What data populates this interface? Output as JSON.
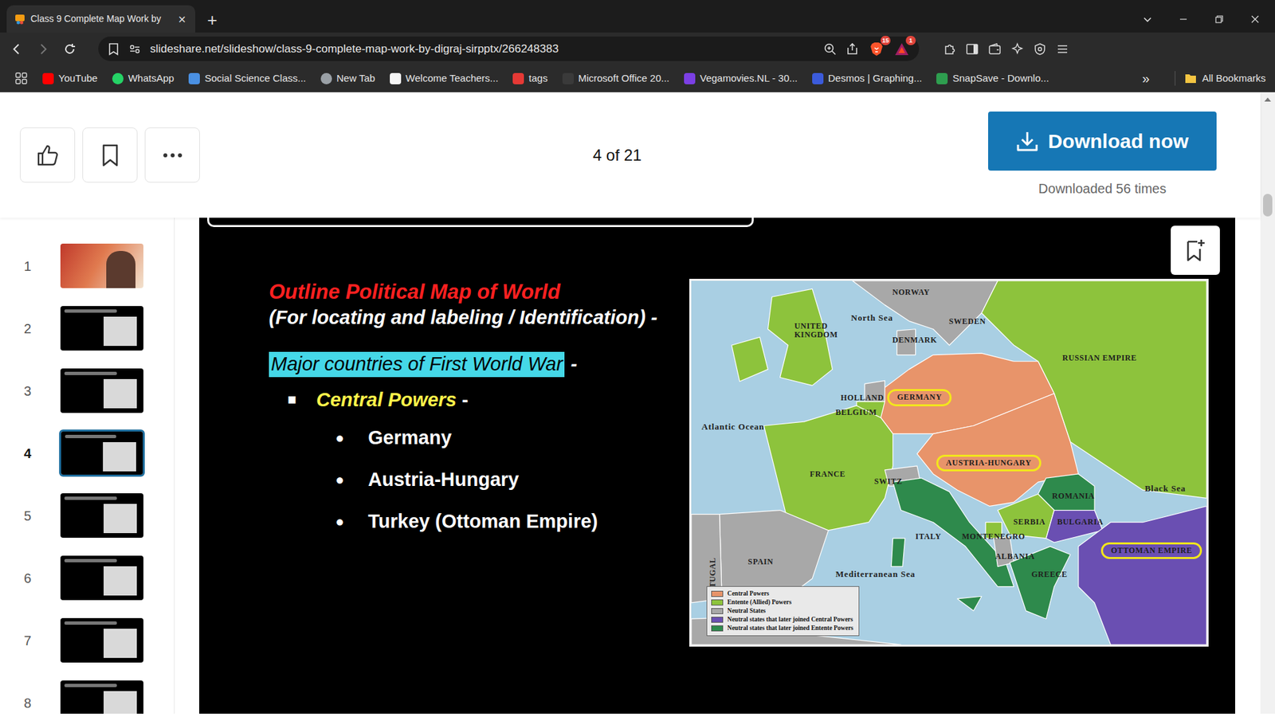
{
  "browser": {
    "tab": {
      "title": "Class 9 Complete Map Work by",
      "close": "×",
      "selected": true
    },
    "new_tab": "+",
    "url": "slideshare.net/slideshow/class-9-complete-map-work-by-digraj-sirpptx/266248383",
    "badges": [
      "15",
      "1"
    ],
    "bookmarks": [
      "YouTube",
      "WhatsApp",
      "Social Science Class...",
      "New Tab",
      "Welcome Teachers...",
      "tags",
      "Microsoft Office 20...",
      "Vegamovies.NL - 30...",
      "Desmos | Graphing...",
      "SnapSave - Downlo..."
    ],
    "bookmarks_overflow": "»",
    "all_bookmarks": "All Bookmarks"
  },
  "toolbar": {
    "page_indicator": "4 of 21",
    "download": "Download now",
    "download_count": "Downloaded 56 times"
  },
  "thumbnails": [
    {
      "number": "1",
      "kind": "cover",
      "selected": false
    },
    {
      "number": "2",
      "kind": "slide",
      "selected": false
    },
    {
      "number": "3",
      "kind": "slide",
      "selected": false
    },
    {
      "number": "4",
      "kind": "slide",
      "selected": true
    },
    {
      "number": "5",
      "kind": "slide",
      "selected": false
    },
    {
      "number": "6",
      "kind": "slide",
      "selected": false
    },
    {
      "number": "7",
      "kind": "slide",
      "selected": false
    },
    {
      "number": "8",
      "kind": "slide",
      "selected": false
    }
  ],
  "slide": {
    "heading": "Outline Political Map of World",
    "subheading": "(For locating and labeling / Identification) -",
    "highlight": "Major countries of First World War",
    "highlight_suffix": "-",
    "group_bullet": "■",
    "group_title": "Central Powers",
    "group_suffix": "-",
    "item_bullet": "●",
    "items": [
      "Germany",
      "Austria-Hungary",
      "Turkey (Ottoman Empire)"
    ]
  },
  "map": {
    "labels": [
      {
        "text": "NORWAY",
        "kind": "land",
        "highlighted": false
      },
      {
        "text": "SWEDEN",
        "kind": "land",
        "highlighted": false
      },
      {
        "text": "North Sea",
        "kind": "sea",
        "highlighted": false
      },
      {
        "text": "UNITED KINGDOM",
        "kind": "wrapbox",
        "highlighted": false
      },
      {
        "text": "DENMARK",
        "kind": "land",
        "highlighted": false
      },
      {
        "text": "RUSSIAN EMPIRE",
        "kind": "land",
        "highlighted": false
      },
      {
        "text": "HOLLAND",
        "kind": "land",
        "highlighted": false
      },
      {
        "text": "BELGIUM",
        "kind": "land",
        "highlighted": false
      },
      {
        "text": "GERMANY",
        "kind": "land",
        "highlighted": true
      },
      {
        "text": "Atlantic Ocean",
        "kind": "sea",
        "highlighted": false
      },
      {
        "text": "FRANCE",
        "kind": "land",
        "highlighted": false
      },
      {
        "text": "SWITZ",
        "kind": "land",
        "highlighted": false
      },
      {
        "text": "AUSTRIA-HUNGARY",
        "kind": "land",
        "highlighted": true
      },
      {
        "text": "ROMANIA",
        "kind": "land",
        "highlighted": false
      },
      {
        "text": "Black Sea",
        "kind": "sea",
        "highlighted": false
      },
      {
        "text": "SERBIA",
        "kind": "land",
        "highlighted": false
      },
      {
        "text": "BULGARIA",
        "kind": "land",
        "highlighted": false
      },
      {
        "text": "ITALY",
        "kind": "land",
        "highlighted": false
      },
      {
        "text": "MONTENEGRO",
        "kind": "land",
        "highlighted": false
      },
      {
        "text": "ALBANIA",
        "kind": "land",
        "highlighted": false
      },
      {
        "text": "SPAIN",
        "kind": "land",
        "highlighted": false
      },
      {
        "text": "OTTOMAN EMPIRE",
        "kind": "land",
        "highlighted": true
      },
      {
        "text": "Mediterranean Sea",
        "kind": "sea",
        "highlighted": false
      },
      {
        "text": "GREECE",
        "kind": "land",
        "highlighted": false
      },
      {
        "text": "PORTUGAL",
        "kind": "vertical",
        "highlighted": false
      }
    ],
    "legend": [
      {
        "text": "Central Powers",
        "color": "#e8946a"
      },
      {
        "text": "Entente (Allied) Powers",
        "color": "#8dc33c"
      },
      {
        "text": "Neutral States",
        "color": "#a8a8a8"
      },
      {
        "text": "Neutral states that later joined Central Powers",
        "color": "#6a4fb2"
      },
      {
        "text": "Neutral states that later joined Entente Powers",
        "color": "#2e8a4c"
      }
    ]
  }
}
